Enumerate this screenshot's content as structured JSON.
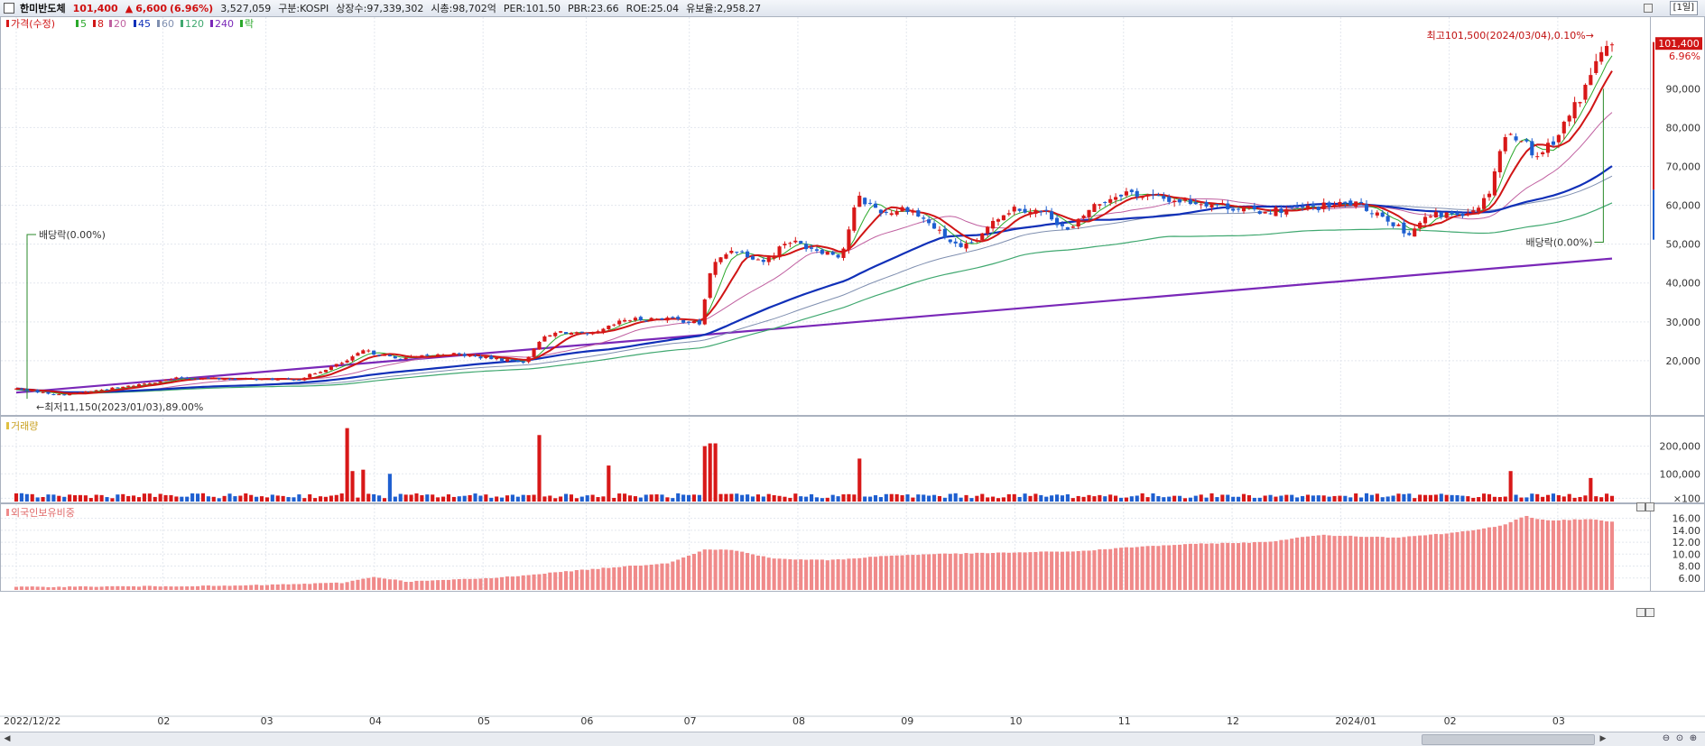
{
  "header": {
    "stock_name": "한미반도체",
    "price": "101,400",
    "change_arrow": "▲",
    "change": "6,600",
    "change_pct": "(6.96%)",
    "volume": "3,527,059",
    "market": "구분:KOSPI",
    "shares": "상장수:97,339,302",
    "market_cap": "시총:98,702억",
    "per": "PER:101.50",
    "pbr": "PBR:23.66",
    "roe": "ROE:25.04",
    "float_shares": "유보율:2,958.27",
    "period": "[1일]"
  },
  "colors": {
    "up": "#d81818",
    "down": "#1e5fd0",
    "ma5": "#2aa82a",
    "ma8": "#d01515",
    "ma20": "#c060a0",
    "ma45": "#1030b8",
    "ma60": "#7f8fb0",
    "ma120": "#40a870",
    "ma240": "#7a28b8",
    "foreign": "#f08a8a"
  },
  "chart_data": [
    {
      "type": "candlestick",
      "legend": [
        "가격(수정)",
        "5",
        "8",
        "20",
        "45",
        "60",
        "120",
        "240",
        "락"
      ],
      "y_ticks": [
        "20,000",
        "30,000",
        "40,000",
        "50,000",
        "60,000",
        "70,000",
        "80,000",
        "90,000"
      ],
      "ylim": [
        10000,
        104000
      ],
      "last_price_label": "101,400",
      "last_pct_label": "6.96%",
      "annotations": {
        "high": "최고101,500(2024/03/04),0.10%→",
        "low": "←최저11,150(2023/01/03),89.00%",
        "dividend_left": "배당락(0.00%)",
        "dividend_right": "배당락(0.00%)"
      },
      "x_labels": [
        "2022/12/22",
        "02",
        "03",
        "04",
        "05",
        "06",
        "07",
        "08",
        "09",
        "10",
        "11",
        "12",
        "2024/01",
        "02",
        "03"
      ],
      "x_label_months": [
        0,
        1.35,
        2.3,
        3.3,
        4.3,
        5.25,
        6.2,
        7.2,
        8.2,
        9.2,
        10.2,
        11.2,
        12.2,
        13.2,
        14.2
      ],
      "monthly_close_anchors": [
        [
          0,
          12800
        ],
        [
          0.4,
          11200
        ],
        [
          1.0,
          13300
        ],
        [
          1.5,
          15600
        ],
        [
          2.0,
          15300
        ],
        [
          2.6,
          15200
        ],
        [
          3.05,
          20000
        ],
        [
          3.2,
          22600
        ],
        [
          3.5,
          20500
        ],
        [
          4.0,
          21800
        ],
        [
          4.4,
          20500
        ],
        [
          4.7,
          19700
        ],
        [
          4.8,
          25000
        ],
        [
          5.0,
          27500
        ],
        [
          5.3,
          26500
        ],
        [
          5.6,
          30500
        ],
        [
          6.0,
          31000
        ],
        [
          6.3,
          29500
        ],
        [
          6.4,
          44000
        ],
        [
          6.6,
          49000
        ],
        [
          6.9,
          45500
        ],
        [
          7.1,
          51000
        ],
        [
          7.4,
          48500
        ],
        [
          7.6,
          47000
        ],
        [
          7.75,
          62000
        ],
        [
          8.0,
          58000
        ],
        [
          8.2,
          59500
        ],
        [
          8.4,
          55500
        ],
        [
          8.7,
          48500
        ],
        [
          8.9,
          52000
        ],
        [
          9.0,
          56500
        ],
        [
          9.2,
          59500
        ],
        [
          9.5,
          58000
        ],
        [
          9.7,
          53000
        ],
        [
          9.9,
          59500
        ],
        [
          10.2,
          63500
        ],
        [
          10.6,
          61500
        ],
        [
          11.0,
          60500
        ],
        [
          11.4,
          58500
        ],
        [
          11.8,
          59000
        ],
        [
          12.3,
          60500
        ],
        [
          12.6,
          57500
        ],
        [
          12.8,
          52500
        ],
        [
          13.0,
          57000
        ],
        [
          13.4,
          58500
        ],
        [
          13.55,
          62000
        ],
        [
          13.7,
          77500
        ],
        [
          13.85,
          78000
        ],
        [
          14.0,
          72500
        ],
        [
          14.2,
          78000
        ],
        [
          14.45,
          90000
        ],
        [
          14.55,
          97000
        ],
        [
          14.7,
          101400
        ]
      ],
      "ma_series": [
        "5",
        "8",
        "20",
        "45",
        "60",
        "120",
        "240"
      ]
    },
    {
      "type": "bar",
      "legend": [
        "거래량"
      ],
      "y_ticks": [
        "200,000",
        "100,000",
        "×100"
      ],
      "ylim": [
        0,
        280000
      ],
      "spikes": [
        {
          "month": 3.05,
          "value": 265000
        },
        {
          "month": 3.1,
          "value": 110000
        },
        {
          "month": 3.2,
          "value": 115000
        },
        {
          "month": 3.45,
          "value": 100000
        },
        {
          "month": 4.8,
          "value": 240000
        },
        {
          "month": 5.45,
          "value": 130000
        },
        {
          "month": 6.35,
          "value": 200000
        },
        {
          "month": 6.42,
          "value": 210000
        },
        {
          "month": 7.75,
          "value": 155000
        },
        {
          "month": 13.75,
          "value": 110000
        },
        {
          "month": 14.5,
          "value": 85000
        }
      ]
    },
    {
      "type": "bar",
      "legend": [
        "외국인보유비중"
      ],
      "y_ticks": [
        "16.00",
        "14.00",
        "12.00",
        "10.00",
        "8.00",
        "6.00"
      ],
      "ylim": [
        4.0,
        17.0
      ],
      "foreign_ratio_anchors": [
        [
          0,
          4.5
        ],
        [
          1.0,
          4.6
        ],
        [
          2.0,
          4.7
        ],
        [
          3.0,
          5.2
        ],
        [
          3.3,
          6.2
        ],
        [
          3.6,
          5.4
        ],
        [
          4.4,
          6.0
        ],
        [
          5.0,
          7.0
        ],
        [
          5.5,
          7.8
        ],
        [
          6.0,
          8.5
        ],
        [
          6.35,
          10.8
        ],
        [
          6.6,
          10.7
        ],
        [
          7.0,
          9.2
        ],
        [
          7.5,
          9.0
        ],
        [
          8.0,
          9.7
        ],
        [
          8.4,
          10.0
        ],
        [
          9.0,
          10.2
        ],
        [
          9.8,
          10.5
        ],
        [
          10.3,
          11.2
        ],
        [
          10.6,
          11.5
        ],
        [
          11.0,
          11.8
        ],
        [
          11.5,
          12.0
        ],
        [
          12.0,
          13.2
        ],
        [
          12.7,
          12.8
        ],
        [
          13.2,
          13.5
        ],
        [
          13.7,
          14.8
        ],
        [
          13.9,
          16.4
        ],
        [
          14.1,
          15.6
        ],
        [
          14.5,
          15.9
        ],
        [
          14.7,
          15.4
        ]
      ]
    }
  ]
}
